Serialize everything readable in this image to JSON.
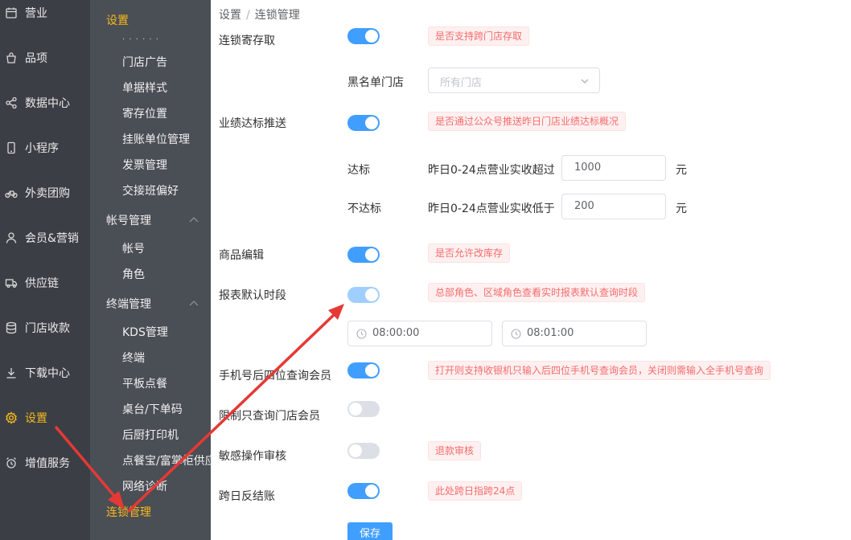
{
  "sidebar": {
    "items": [
      {
        "label": "营业",
        "icon": "calendar-icon"
      },
      {
        "label": "品项",
        "icon": "bag-icon"
      },
      {
        "label": "数据中心",
        "icon": "share-icon"
      },
      {
        "label": "小程序",
        "icon": "phone-icon"
      },
      {
        "label": "外卖团购",
        "icon": "bike-icon"
      },
      {
        "label": "会员&营销",
        "icon": "user-icon"
      },
      {
        "label": "供应链",
        "icon": "truck-icon"
      },
      {
        "label": "门店收款",
        "icon": "database-icon"
      },
      {
        "label": "下载中心",
        "icon": "download-icon"
      },
      {
        "label": "设置",
        "icon": "gear-icon",
        "active": true
      },
      {
        "label": "增值服务",
        "icon": "alarm-icon"
      }
    ]
  },
  "submenu": {
    "header": "设置",
    "items_top": [
      "门店广告",
      "单据样式",
      "寄存位置",
      "挂账单位管理",
      "发票管理",
      "交接班偏好"
    ],
    "group_account": "帐号管理",
    "account_items": [
      "帐号",
      "角色"
    ],
    "group_terminal": "终端管理",
    "terminal_items": [
      "KDS管理",
      "终端",
      "平板点餐",
      "桌台/下单码",
      "后厨打印机",
      "点餐宝/富掌柜供应",
      "网络诊断"
    ],
    "active_item": "连锁管理"
  },
  "breadcrumb": {
    "root": "设置",
    "sep": "/",
    "current": "连锁管理"
  },
  "form": {
    "chain_deposit": {
      "label": "连锁寄存取",
      "enabled": true,
      "tip": "是否支持跨门店存取"
    },
    "blacklist": {
      "label": "黑名单门店",
      "placeholder": "所有门店"
    },
    "performance_push": {
      "label": "业绩达标推送",
      "enabled": true,
      "tip": "是否通过公众号推送昨日门店业绩达标概况"
    },
    "reach": {
      "label": "达标",
      "desc": "昨日0-24点营业实收超过",
      "value": "1000",
      "unit": "元"
    },
    "not_reach": {
      "label": "不达标",
      "desc": "昨日0-24点营业实收低于",
      "value": "200",
      "unit": "元"
    },
    "goods_edit": {
      "label": "商品编辑",
      "enabled": true,
      "tip": "是否允许改库存"
    },
    "report_period": {
      "label": "报表默认时段",
      "enabled": true,
      "disabled": true,
      "tip": "总部角色、区域角色查看实时报表默认查询时段",
      "start": "08:00:00",
      "end": "08:01:00"
    },
    "phone_last4": {
      "label": "手机号后四位查询会员",
      "enabled": true,
      "tip": "打开则支持收银机只输入后四位手机号查询会员，关闭则需输入全手机号查询"
    },
    "limit_store_member": {
      "label": "限制只查询门店会员",
      "enabled": false
    },
    "sensitive_audit": {
      "label": "敏感操作审核",
      "enabled": false,
      "tip": "退款审核"
    },
    "cross_day": {
      "label": "跨日反结账",
      "enabled": true,
      "tip": "此处跨日指跨24点"
    },
    "save_label": "保存"
  },
  "colors": {
    "primary": "#409eff",
    "accent": "#f5b81c",
    "danger": "#f56c6c",
    "arrow": "#e53935"
  }
}
